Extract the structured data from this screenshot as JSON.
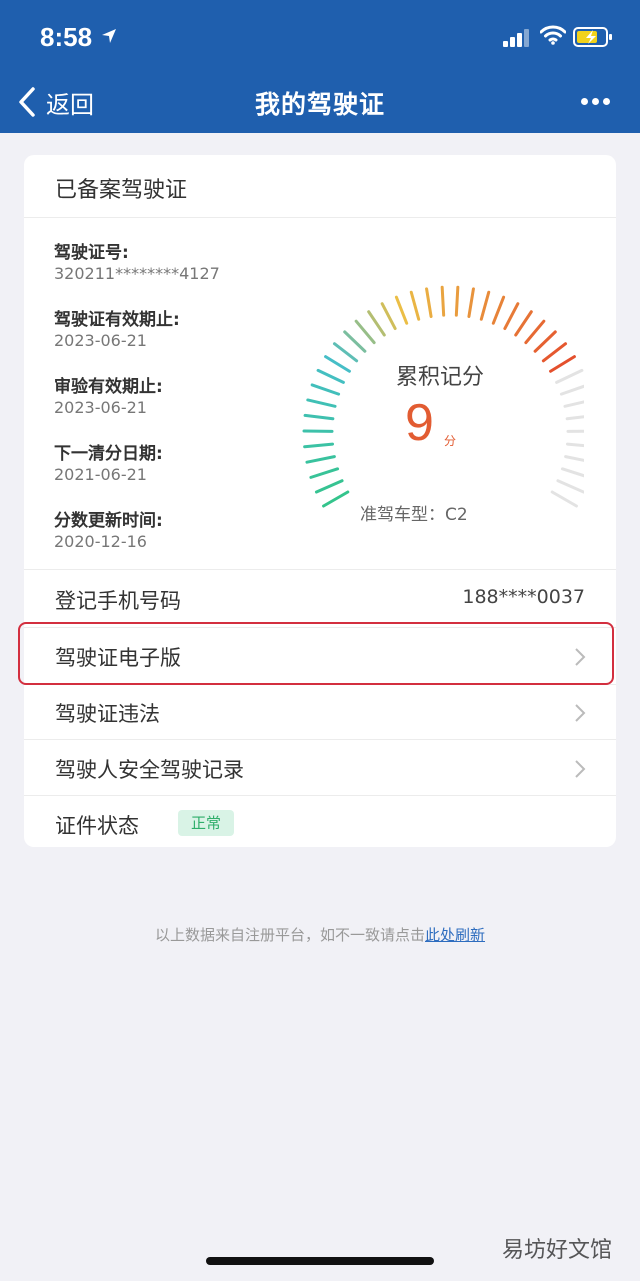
{
  "status_bar": {
    "time": "8:58"
  },
  "nav": {
    "back_label": "返回",
    "title": "我的驾驶证"
  },
  "card": {
    "title": "已备案驾驶证",
    "fields": [
      {
        "label": "驾驶证号:",
        "value": "320211********4127"
      },
      {
        "label": "驾驶证有效期止:",
        "value": "2023-06-21"
      },
      {
        "label": "审验有效期止:",
        "value": "2023-06-21"
      },
      {
        "label": "下一清分日期:",
        "value": "2021-06-21"
      },
      {
        "label": "分数更新时间:",
        "value": "2020-12-16"
      }
    ],
    "gauge": {
      "label": "累积记分",
      "score": "9",
      "unit": "分",
      "car_type": "准驾车型：C2",
      "score_value": 9,
      "max_score": 12
    },
    "phone_row": {
      "label": "登记手机号码",
      "value": "188****0037"
    },
    "links": [
      {
        "label": "驾驶证电子版"
      },
      {
        "label": "驾驶证违法"
      },
      {
        "label": "驾驶人安全驾驶记录"
      }
    ],
    "status_row": {
      "label": "证件状态",
      "badge": "正常"
    }
  },
  "footer": {
    "note": "以上数据来自注册平台，如不一致请点击",
    "link": "此处刷新"
  },
  "watermark": "易坊好文馆",
  "colors": {
    "header_bg": "#1f5fae",
    "accent_orange": "#e25c32",
    "highlight_red": "#d32f3f",
    "status_green": "#2eae6a",
    "link_blue": "#2e6dbf"
  }
}
